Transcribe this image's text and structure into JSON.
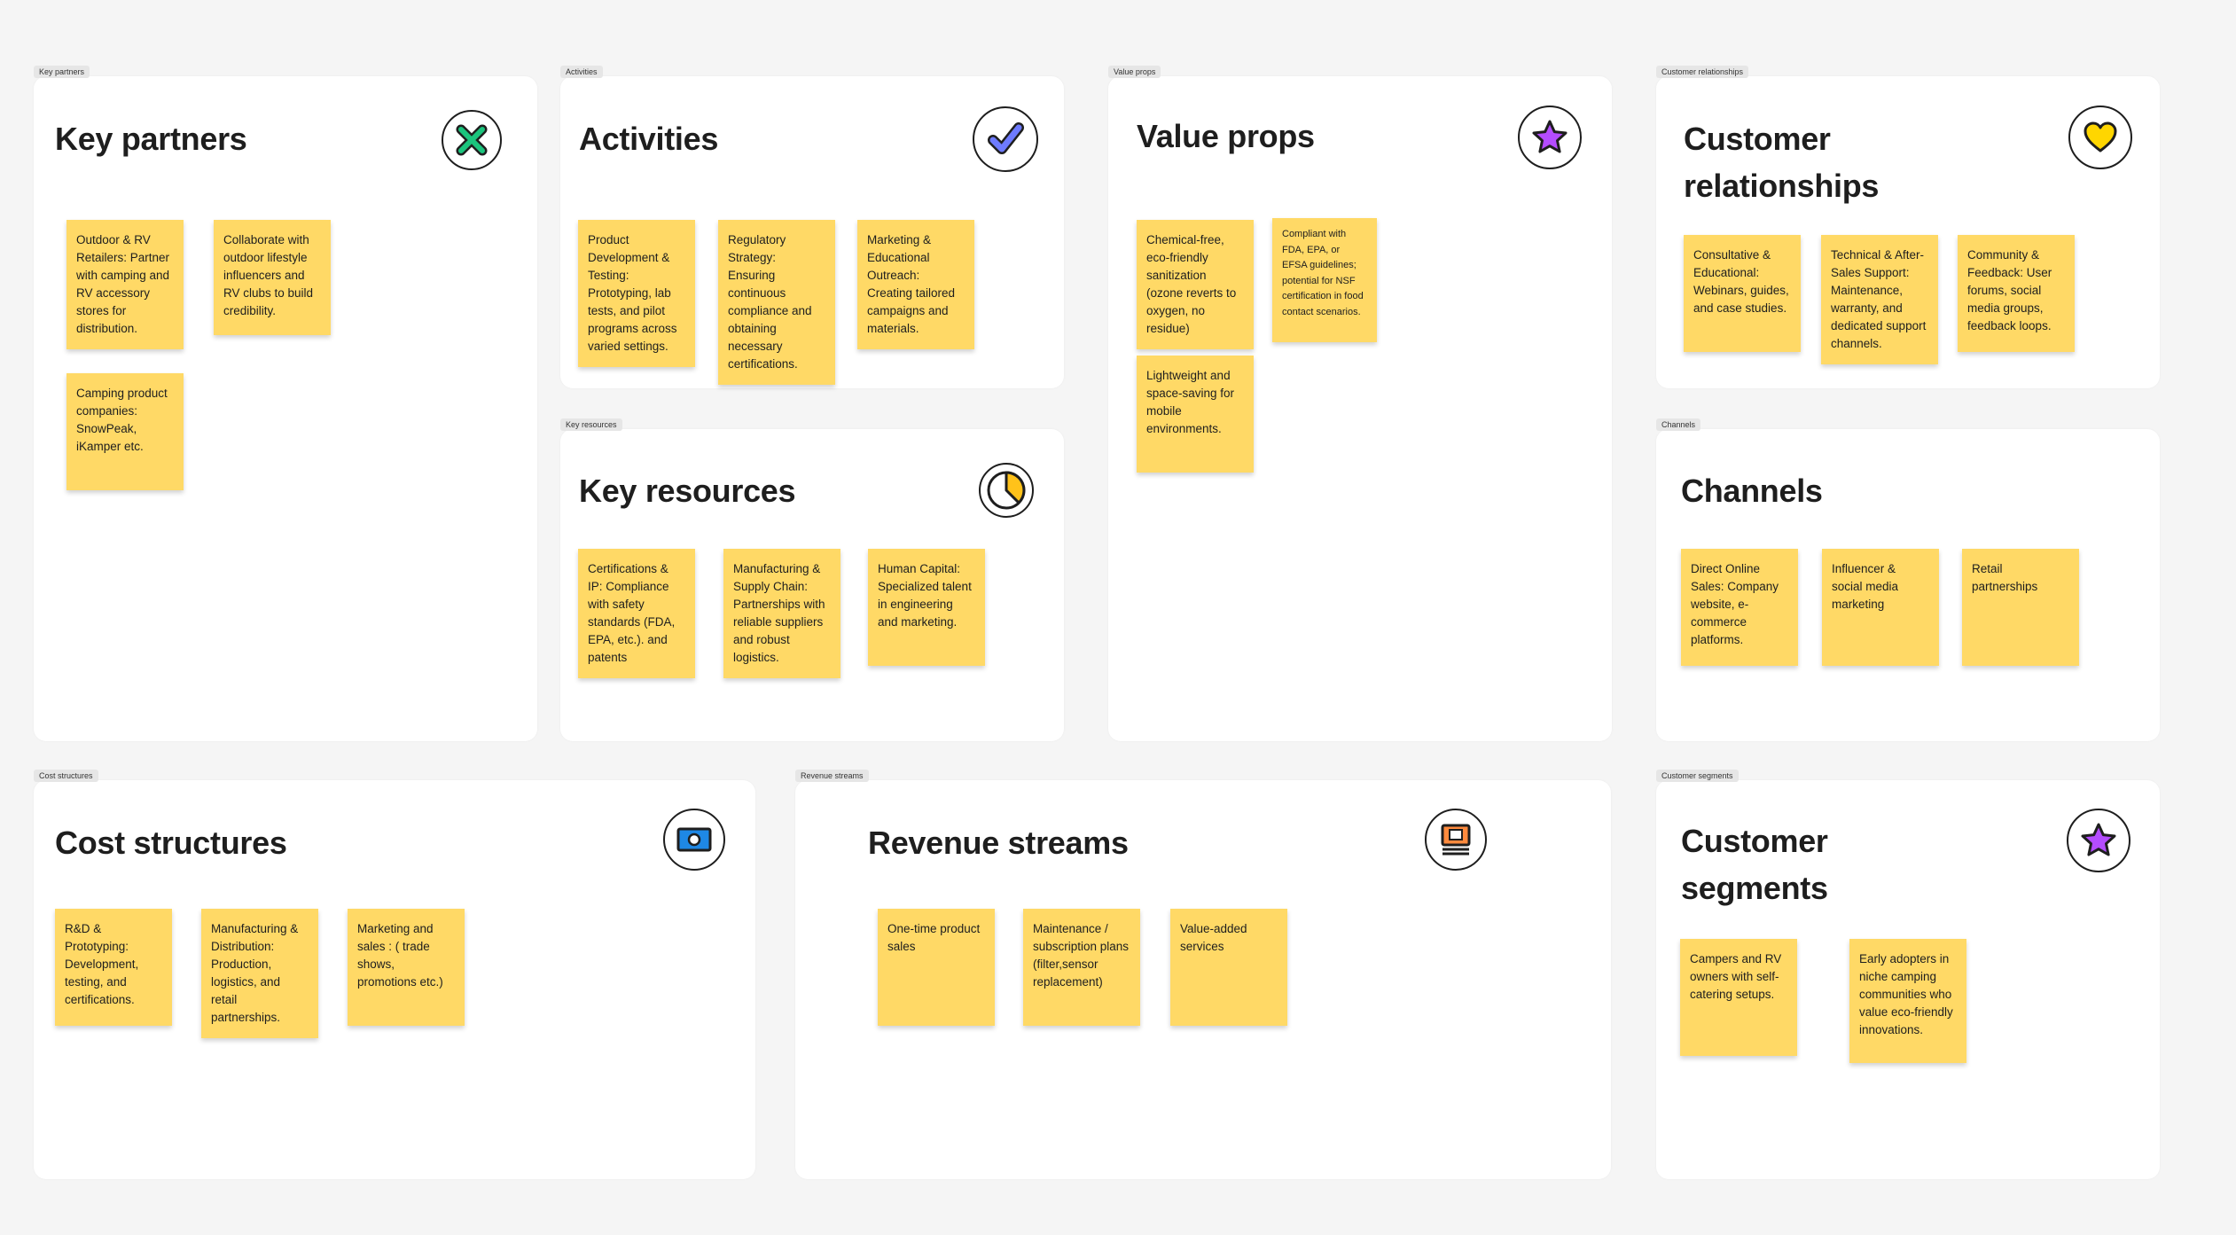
{
  "sections": {
    "key_partners": {
      "tag": "Key partners",
      "title": "Key partners",
      "notes": [
        "Outdoor & RV Retailers: Partner with camping and RV accessory stores for distribution.",
        "Collaborate with outdoor lifestyle influencers and RV clubs to build credibility.",
        "Camping product companies: SnowPeak, iKamper etc."
      ]
    },
    "activities": {
      "tag": "Activities",
      "title": "Activities",
      "notes": [
        "Product Development & Testing: Prototyping, lab tests, and pilot programs across varied settings.",
        "Regulatory Strategy: Ensuring continuous compliance and obtaining necessary certifications.",
        "Marketing & Educational Outreach: Creating tailored campaigns and materials."
      ]
    },
    "key_resources": {
      "tag": "Key resources",
      "title": "Key resources",
      "notes": [
        "Certifications & IP: Compliance with safety standards (FDA, EPA, etc.). and patents",
        "Manufacturing & Supply Chain: Partnerships with reliable suppliers and robust logistics.",
        "Human Capital: Specialized talent in engineering and marketing."
      ]
    },
    "value_props": {
      "tag": "Value props",
      "title": "Value props",
      "notes": [
        "Chemical-free, eco-friendly sanitization (ozone reverts to oxygen, no residue)",
        "Compliant with FDA, EPA, or EFSA guidelines; potential for NSF certification in food contact scenarios.",
        "Lightweight and space-saving for mobile environments."
      ]
    },
    "customer_relationships": {
      "tag": "Customer relationships",
      "title_line1": "Customer",
      "title_line2": "relationships",
      "notes": [
        "Consultative & Educational: Webinars, guides, and case studies.",
        "Technical & After-Sales Support: Maintenance, warranty, and dedicated support channels.",
        "Community & Feedback: User forums, social media groups, feedback loops."
      ]
    },
    "channels": {
      "tag": "Channels",
      "title": "Channels",
      "notes": [
        "Direct Online Sales: Company website, e-commerce platforms.",
        "Influencer & social media marketing",
        "Retail partnerships"
      ]
    },
    "cost_structures": {
      "tag": "Cost structures",
      "title": "Cost structures",
      "notes": [
        "R&D & Prototyping: Development, testing, and certifications.",
        "Manufacturing & Distribution: Production, logistics, and retail partnerships.",
        "Marketing and sales : ( trade shows, promotions etc.)"
      ]
    },
    "revenue_streams": {
      "tag": "Revenue streams",
      "title": "Revenue streams",
      "notes": [
        "One-time product sales",
        "Maintenance / subscription plans (filter,sensor replacement)",
        "Value-added services"
      ]
    },
    "customer_segments": {
      "tag": "Customer segments",
      "title_line1": "Customer",
      "title_line2": "segments",
      "notes": [
        "Campers and RV owners with self-catering setups.",
        "Early adopters in niche camping communities who value eco-friendly innovations."
      ]
    }
  },
  "icons": {
    "key_partners": "x-mark-icon",
    "activities": "check-icon",
    "key_resources": "pie-chart-icon",
    "value_props": "star-icon",
    "customer_relationships": "heart-icon",
    "channels": "none",
    "cost_structures": "money-icon",
    "revenue_streams": "receipt-icon",
    "customer_segments": "star-icon"
  },
  "colors": {
    "background": "#f5f5f5",
    "section": "#ffffff",
    "sticky": "#ffd966",
    "x_mark": "#1bc47d",
    "check": "#6e7bff",
    "star": "#b44cff",
    "heart": "#ffd600",
    "pie": "#ffc21a",
    "money": "#1e88e5",
    "receipt": "#ff8a3d"
  }
}
